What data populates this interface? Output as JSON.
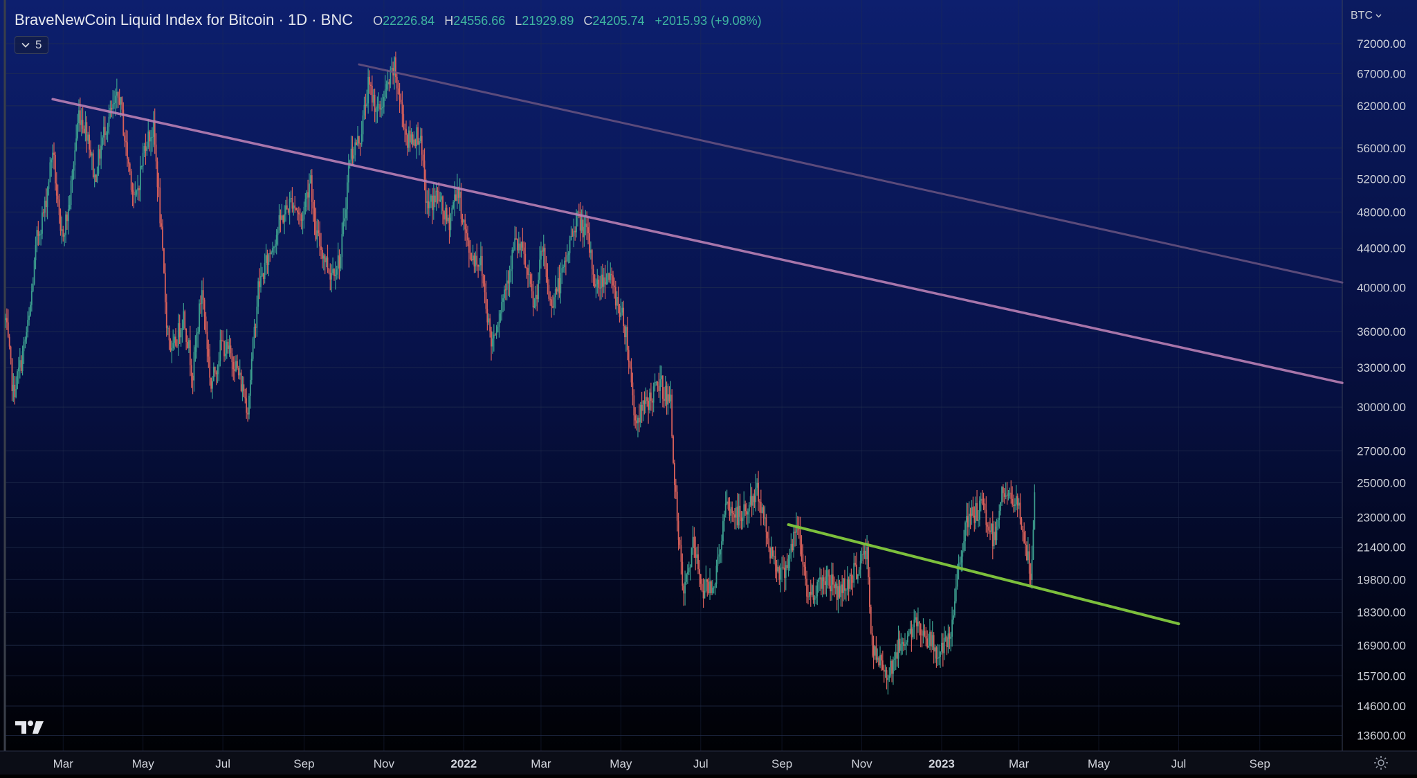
{
  "legend": {
    "symbol_title": "BraveNewCoin Liquid Index for Bitcoin · 1D · BNC",
    "ohlc": [
      {
        "key": "O",
        "value": "22226.84"
      },
      {
        "key": "H",
        "value": "24556.66"
      },
      {
        "key": "L",
        "value": "21929.89"
      },
      {
        "key": "C",
        "value": "24205.74"
      }
    ],
    "change": "+2015.93 (+9.08%)",
    "indicator_toggle_count": "5"
  },
  "currency_label": "BTC",
  "icons": {
    "collapse": "chevron-down-icon",
    "currency_menu": "chevron-down-icon",
    "brand": "tradingview-logo-icon",
    "settings": "gear-icon"
  },
  "colors": {
    "background_top": "#0d1f6e",
    "background_bottom": "#000000",
    "up_candle": "#3c9e8e",
    "down_candle": "#d8605a",
    "trendline_upper": "#6a5480",
    "trendline_mid": "#b980b4",
    "trendline_support": "#7cbf3c",
    "axis_text": "#d1d4dc",
    "grid": "#24304f"
  },
  "chart_data": {
    "type": "candlestick",
    "title": "BraveNewCoin Liquid Index for Bitcoin · 1D · BNC",
    "interval": "1D",
    "scale": "log",
    "grid": true,
    "y_ticks": [
      "72000.00",
      "67000.00",
      "62000.00",
      "56000.00",
      "52000.00",
      "48000.00",
      "44000.00",
      "40000.00",
      "36000.00",
      "33000.00",
      "30000.00",
      "27000.00",
      "25000.00",
      "23000.00",
      "21400.00",
      "19800.00",
      "18300.00",
      "16900.00",
      "15700.00",
      "14600.00",
      "13600.00"
    ],
    "x_ticks": [
      {
        "label": "Mar",
        "date": "2021-03-01"
      },
      {
        "label": "May",
        "date": "2021-05-01"
      },
      {
        "label": "Jul",
        "date": "2021-07-01"
      },
      {
        "label": "Sep",
        "date": "2021-09-01"
      },
      {
        "label": "Nov",
        "date": "2021-11-01"
      },
      {
        "label": "2022",
        "date": "2022-01-01"
      },
      {
        "label": "Mar",
        "date": "2022-03-01"
      },
      {
        "label": "May",
        "date": "2022-05-01"
      },
      {
        "label": "Jul",
        "date": "2022-07-01"
      },
      {
        "label": "Sep",
        "date": "2022-09-01"
      },
      {
        "label": "Nov",
        "date": "2022-11-01"
      },
      {
        "label": "2023",
        "date": "2023-01-01"
      },
      {
        "label": "Mar",
        "date": "2023-03-01"
      },
      {
        "label": "May",
        "date": "2023-05-01"
      },
      {
        "label": "Jul",
        "date": "2023-07-01"
      },
      {
        "label": "Sep",
        "date": "2023-09-01"
      }
    ],
    "x_range": [
      "2021-01-16",
      "2023-11-03"
    ],
    "y_range": [
      13100,
      80000
    ],
    "price_path": [
      [
        "2021-01-16",
        37000
      ],
      [
        "2021-01-22",
        31000
      ],
      [
        "2021-01-28",
        33500
      ],
      [
        "2021-02-03",
        37000
      ],
      [
        "2021-02-09",
        45000
      ],
      [
        "2021-02-15",
        48500
      ],
      [
        "2021-02-21",
        56000
      ],
      [
        "2021-02-27",
        45000
      ],
      [
        "2021-03-05",
        48000
      ],
      [
        "2021-03-13",
        61000
      ],
      [
        "2021-03-20",
        58000
      ],
      [
        "2021-03-25",
        52000
      ],
      [
        "2021-04-02",
        59000
      ],
      [
        "2021-04-13",
        63500
      ],
      [
        "2021-04-18",
        56000
      ],
      [
        "2021-04-25",
        49000
      ],
      [
        "2021-05-03",
        57000
      ],
      [
        "2021-05-09",
        58500
      ],
      [
        "2021-05-13",
        50000
      ],
      [
        "2021-05-19",
        37000
      ],
      [
        "2021-05-23",
        34000
      ],
      [
        "2021-06-01",
        37500
      ],
      [
        "2021-06-08",
        32500
      ],
      [
        "2021-06-15",
        40000
      ],
      [
        "2021-06-22",
        31500
      ],
      [
        "2021-06-30",
        35000
      ],
      [
        "2021-07-10",
        33500
      ],
      [
        "2021-07-20",
        30000
      ],
      [
        "2021-07-28",
        40000
      ],
      [
        "2021-08-07",
        44000
      ],
      [
        "2021-08-14",
        47000
      ],
      [
        "2021-08-23",
        49500
      ],
      [
        "2021-08-30",
        47000
      ],
      [
        "2021-09-06",
        52500
      ],
      [
        "2021-09-09",
        46000
      ],
      [
        "2021-09-21",
        41500
      ],
      [
        "2021-09-29",
        43000
      ],
      [
        "2021-10-06",
        55000
      ],
      [
        "2021-10-14",
        57500
      ],
      [
        "2021-10-20",
        65000
      ],
      [
        "2021-10-28",
        61000
      ],
      [
        "2021-11-09",
        68000
      ],
      [
        "2021-11-12",
        64000
      ],
      [
        "2021-11-19",
        57000
      ],
      [
        "2021-11-28",
        58000
      ],
      [
        "2021-12-04",
        48500
      ],
      [
        "2021-12-12",
        50000
      ],
      [
        "2021-12-20",
        46500
      ],
      [
        "2021-12-27",
        51000
      ],
      [
        "2022-01-05",
        43500
      ],
      [
        "2022-01-14",
        42500
      ],
      [
        "2022-01-22",
        35000
      ],
      [
        "2022-01-28",
        37500
      ],
      [
        "2022-02-09",
        44500
      ],
      [
        "2022-02-15",
        43500
      ],
      [
        "2022-02-24",
        38000
      ],
      [
        "2022-03-02",
        44000
      ],
      [
        "2022-03-08",
        38500
      ],
      [
        "2022-03-17",
        41000
      ],
      [
        "2022-03-28",
        47500
      ],
      [
        "2022-04-05",
        45500
      ],
      [
        "2022-04-12",
        40000
      ],
      [
        "2022-04-21",
        41500
      ],
      [
        "2022-04-29",
        38500
      ],
      [
        "2022-05-05",
        36000
      ],
      [
        "2022-05-12",
        29000
      ],
      [
        "2022-05-19",
        30000
      ],
      [
        "2022-05-31",
        31800
      ],
      [
        "2022-06-08",
        30200
      ],
      [
        "2022-06-13",
        22500
      ],
      [
        "2022-06-18",
        19000
      ],
      [
        "2022-06-25",
        21500
      ],
      [
        "2022-07-03",
        19300
      ],
      [
        "2022-07-12",
        19800
      ],
      [
        "2022-07-20",
        23500
      ],
      [
        "2022-08-01",
        23000
      ],
      [
        "2022-08-14",
        24500
      ],
      [
        "2022-08-22",
        21500
      ],
      [
        "2022-09-01",
        20000
      ],
      [
        "2022-09-09",
        21500
      ],
      [
        "2022-09-13",
        22500
      ],
      [
        "2022-09-21",
        19000
      ],
      [
        "2022-10-05",
        20000
      ],
      [
        "2022-10-14",
        19200
      ],
      [
        "2022-10-25",
        20000
      ],
      [
        "2022-11-05",
        21200
      ],
      [
        "2022-11-09",
        16600
      ],
      [
        "2022-11-21",
        15800
      ],
      [
        "2022-12-01",
        17000
      ],
      [
        "2022-12-14",
        17800
      ],
      [
        "2022-12-30",
        16550
      ],
      [
        "2023-01-08",
        17100
      ],
      [
        "2023-01-14",
        20800
      ],
      [
        "2023-01-21",
        22800
      ],
      [
        "2023-02-01",
        23600
      ],
      [
        "2023-02-10",
        21800
      ],
      [
        "2023-02-16",
        24600
      ],
      [
        "2023-02-22",
        24000
      ],
      [
        "2023-03-01",
        23600
      ],
      [
        "2023-03-09",
        20300
      ],
      [
        "2023-03-10",
        20150
      ],
      [
        "2023-03-12",
        21900
      ],
      [
        "2023-03-13",
        24200
      ]
    ],
    "trendlines": [
      {
        "from": [
          "2021-10-13",
          68500
        ],
        "to": [
          "2023-11-03",
          40500
        ],
        "color": "#6a5480",
        "width": 3,
        "opacity": 0.85
      },
      {
        "from": [
          "2021-02-21",
          63000
        ],
        "to": [
          "2023-11-03",
          31800
        ],
        "color": "#b980b4",
        "width": 3.5,
        "opacity": 0.9
      },
      {
        "from": [
          "2022-09-06",
          22600
        ],
        "to": [
          "2023-07-01",
          17800
        ],
        "color": "#7cbf3c",
        "width": 4,
        "opacity": 1
      }
    ]
  }
}
